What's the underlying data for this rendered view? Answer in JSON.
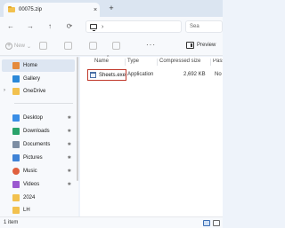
{
  "window": {
    "tab_title": "00075.zip",
    "tab_close": "×",
    "new_tab": "+"
  },
  "nav": {
    "back": "←",
    "forward": "→",
    "up": "↑",
    "refresh": "⟳",
    "address_chevron": "›",
    "search_placeholder": "Sea"
  },
  "commandbar": {
    "new_label": "New",
    "new_chevron": "⌄",
    "more": "···",
    "preview_label": "Preview"
  },
  "sidebar": {
    "items": [
      {
        "label": "Home",
        "icon": "home-icon",
        "color": "#e58a3c"
      },
      {
        "label": "Gallery",
        "icon": "gallery-icon",
        "color": "#2b88d8"
      },
      {
        "label": "OneDrive",
        "icon": "folder-icon",
        "color": "#f2c14e"
      },
      {
        "label": "Desktop",
        "icon": "desktop-icon",
        "color": "#3a8ee6"
      },
      {
        "label": "Downloads",
        "icon": "download-icon",
        "color": "#2aa36b"
      },
      {
        "label": "Documents",
        "icon": "documents-icon",
        "color": "#7d8ea3"
      },
      {
        "label": "Pictures",
        "icon": "pictures-icon",
        "color": "#3f83d6"
      },
      {
        "label": "Music",
        "icon": "music-icon",
        "color": "#e0603e"
      },
      {
        "label": "Videos",
        "icon": "videos-icon",
        "color": "#9b59d0"
      },
      {
        "label": "2024",
        "icon": "folder-icon",
        "color": "#f2c14e"
      },
      {
        "label": "LH",
        "icon": "folder-icon",
        "color": "#f2c14e"
      }
    ],
    "expand_glyph": "›",
    "pin_glyph": "✱"
  },
  "main": {
    "columns": [
      "Name",
      "Type",
      "Compressed size",
      "Pass"
    ],
    "sort_glyph": "^",
    "files": [
      {
        "name": "Sheets.exe",
        "type": "Application",
        "compressed_size": "2,692 KB",
        "password": "No"
      }
    ]
  },
  "status": {
    "count": "1 item"
  }
}
